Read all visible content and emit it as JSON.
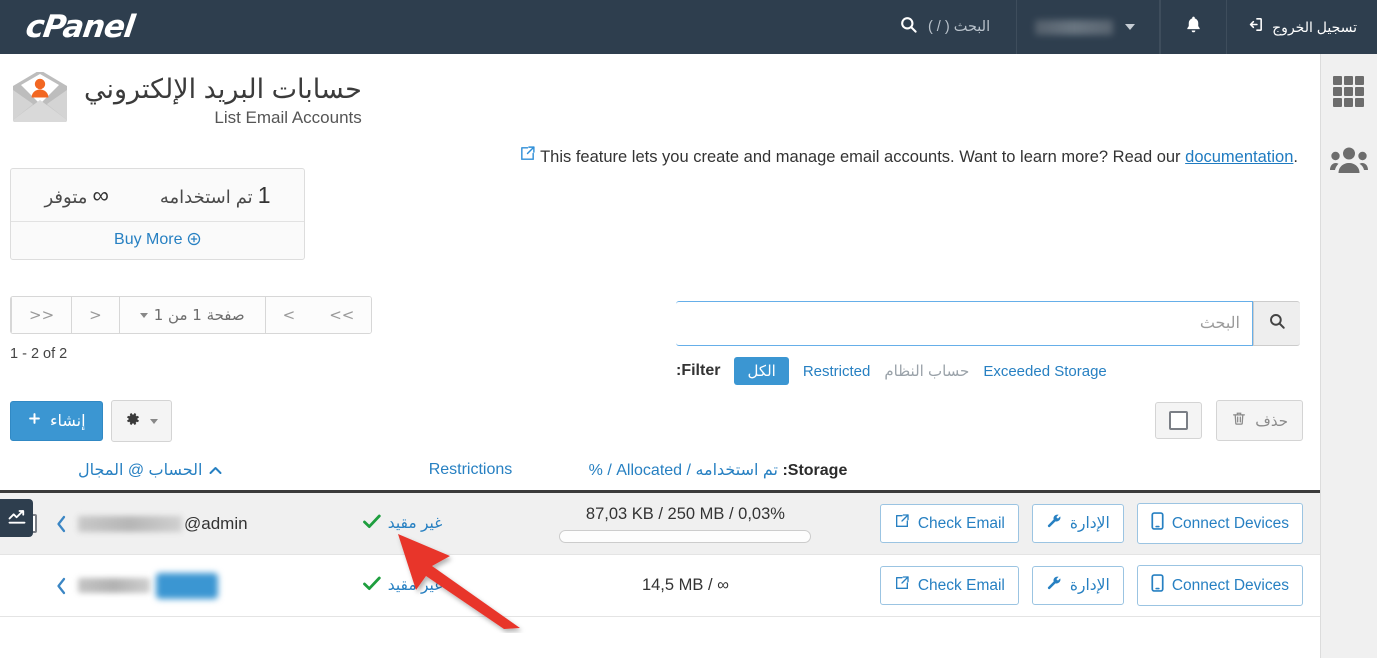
{
  "nav": {
    "logo_text": "cPanel",
    "search_placeholder": "البحث ( / )",
    "search_icon": "search-icon",
    "user_name_blurred": "",
    "bell_icon": "bell-icon",
    "logout_label": "تسجيل الخروج",
    "logout_icon": "logout-icon"
  },
  "rail": {
    "grid_icon": "apps-grid-icon",
    "users_icon": "users-icon"
  },
  "header": {
    "title": "حسابات البريد الإلكتروني",
    "subtitle": "List Email Accounts",
    "icon": "email-accounts-icon"
  },
  "description": {
    "text": "This feature lets you create and manage email accounts. Want to learn more? Read our ",
    "link_label": "documentation",
    "trailing": ".",
    "external_icon": "external-link-icon"
  },
  "quota": {
    "available_value": "∞",
    "available_label": "متوفر",
    "used_value": "1",
    "used_label": "تم استخدامه",
    "buy_more_label": "Buy More",
    "buy_more_icon": "plus-circle-icon"
  },
  "pager": {
    "first_label": "<<",
    "prev_label": "<",
    "page_label": "صفحة 1 من 1",
    "next_label": ">",
    "last_label": ">>",
    "count_text": "1 - 2 of 2"
  },
  "search": {
    "placeholder": "البحث",
    "value": "",
    "button_icon": "search-icon"
  },
  "filter": {
    "label": "Filter:",
    "options": [
      {
        "label": "الكل",
        "active": true,
        "muted": false
      },
      {
        "label": "Restricted",
        "active": false,
        "muted": false
      },
      {
        "label": "حساب النظام",
        "active": false,
        "muted": true
      },
      {
        "label": "Exceeded Storage",
        "active": false,
        "muted": false
      }
    ]
  },
  "toolbar": {
    "create_label": "إنشاء",
    "create_icon": "plus-icon",
    "gear_icon": "gear-icon",
    "gear_caret_icon": "chevron-down-icon",
    "delete_label": "حذف",
    "delete_icon": "trash-icon",
    "select_all_icon": "checkbox-icon"
  },
  "table": {
    "headers": {
      "account": "الحساب @ المجال",
      "account_sort_icon": "sort-asc-icon",
      "restrictions": "Restrictions",
      "storage_label": "Storage:",
      "storage_used": "تم استخدامه",
      "storage_allocated": "Allocated",
      "storage_percent": "%",
      "storage_sep": "/"
    },
    "rows": [
      {
        "account_prefix": "admin@",
        "account_domain_blurred": true,
        "account_highlighted": false,
        "restriction": "غير مقيد",
        "restriction_icon": "check-icon",
        "storage": "87,03 KB / 250 MB / 0,03%",
        "progress_percent": 0.03,
        "has_progress_bar": true,
        "has_checkbox": true,
        "chevron_icon": "chevron-left-icon",
        "actions": [
          {
            "label": "Check Email",
            "icon": "external-link-icon"
          },
          {
            "label": "الإدارة",
            "icon": "wrench-icon"
          },
          {
            "label": "Connect Devices",
            "icon": "mobile-icon"
          }
        ]
      },
      {
        "account_prefix": "",
        "account_domain_blurred": true,
        "account_highlighted": true,
        "restriction": "غير مقيد",
        "restriction_icon": "check-icon",
        "storage": "14,5 MB / ∞",
        "progress_percent": 0,
        "has_progress_bar": false,
        "has_checkbox": false,
        "chevron_icon": "chevron-left-icon",
        "actions": [
          {
            "label": "Check Email",
            "icon": "external-link-icon"
          },
          {
            "label": "الإدارة",
            "icon": "wrench-icon"
          },
          {
            "label": "Connect Devices",
            "icon": "mobile-icon"
          }
        ]
      }
    ]
  },
  "stats_tab": {
    "icon": "stats-chart-icon"
  },
  "annotation": {
    "arrow_icon": "red-arrow-annotation",
    "color": "#e8342c"
  },
  "colors": {
    "nav_bg": "#2e3e4e",
    "accent_blue": "#3b96d2",
    "link_blue": "#2780c2",
    "green": "#1e9e3e",
    "orange": "#f26722",
    "annotation_red": "#e8342c"
  }
}
